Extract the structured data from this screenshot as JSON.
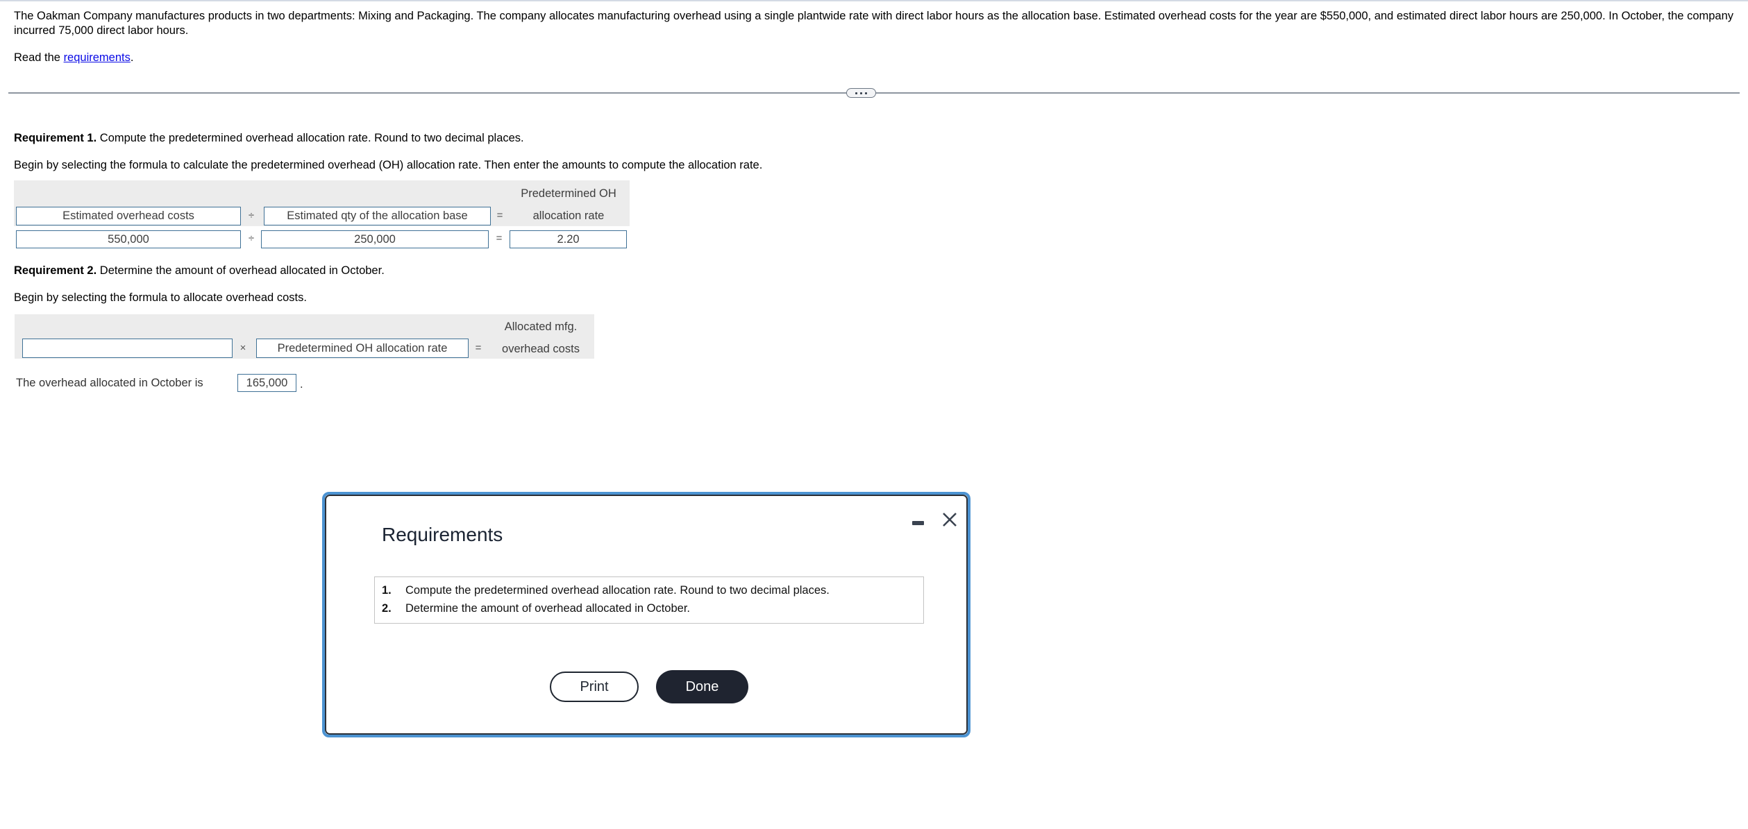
{
  "problem": {
    "intro": "The Oakman Company manufactures products in two departments: Mixing and Packaging. The company allocates manufacturing overhead using a single plantwide rate with direct labor hours as the allocation base. Estimated overhead costs for the year are $550,000, and estimated direct labor hours are 250,000. In October, the company incurred 75,000 direct labor hours.",
    "read_prefix": "Read the ",
    "read_link": "requirements",
    "read_suffix": "."
  },
  "requirement1": {
    "label": "Requirement 1.",
    "text": " Compute the predetermined overhead allocation rate. Round to two decimal places.",
    "instruction": "Begin by selecting the formula to calculate the predetermined overhead (OH) allocation rate. Then enter the amounts to compute the allocation rate.",
    "formula": {
      "term1": "Estimated overhead costs",
      "op1": "÷",
      "term2": "Estimated qty of the allocation base",
      "op2": "=",
      "result_line1": "Predetermined OH",
      "result_line2": "allocation rate"
    },
    "values": {
      "value1": "550,000",
      "op1": "÷",
      "value2": "250,000",
      "op2": "=",
      "result": "2.20"
    }
  },
  "requirement2": {
    "label": "Requirement 2.",
    "text": " Determine the amount of overhead allocated in October.",
    "instruction": "Begin by selecting the formula to allocate overhead costs.",
    "formula": {
      "term1": "",
      "op1": "×",
      "term2": "Predetermined OH allocation rate",
      "op2": "=",
      "result_line1": "Allocated mfg.",
      "result_line2": "overhead costs"
    },
    "answer_label": "The overhead allocated in October is",
    "answer_value": "165,000",
    "answer_suffix": "."
  },
  "modal": {
    "title": "Requirements",
    "items": [
      {
        "num": "1.",
        "text": "Compute the predetermined overhead allocation rate. Round to two decimal places."
      },
      {
        "num": "2.",
        "text": "Determine the amount of overhead allocated in October."
      }
    ],
    "print_label": "Print",
    "done_label": "Done"
  },
  "colors": {
    "link": "#0a0ae6",
    "input_border": "#3f7196",
    "modal_ring": "#4c93d2",
    "done_button": "#1f2430"
  }
}
